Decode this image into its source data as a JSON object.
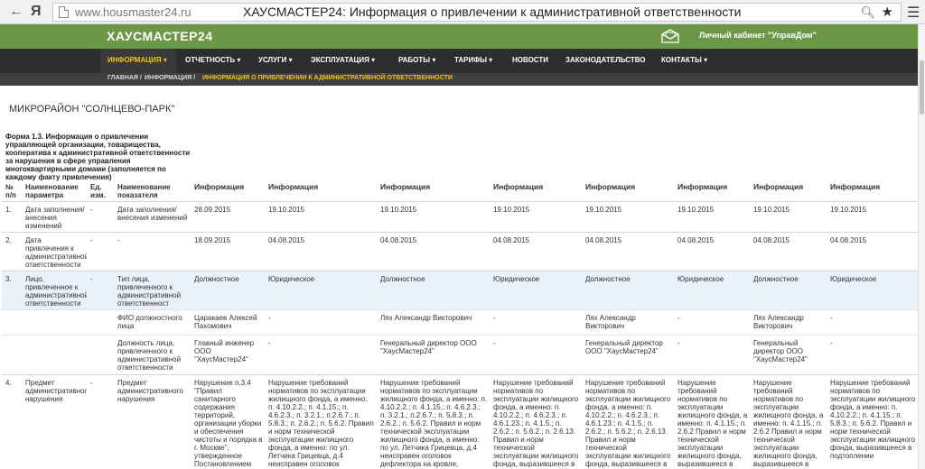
{
  "browser": {
    "back_glyph": "←",
    "brand_glyph": "Я",
    "url": "www.housmaster24.ru",
    "page_title": "ХАУСМАСТЕР24: Информация о привлечении к административной ответственности"
  },
  "header": {
    "logo": "ХАУСМАСТЕР24",
    "cabinet": "Личный кабинет \"УправДом\""
  },
  "nav": {
    "items": [
      {
        "label": "Информация ▾"
      },
      {
        "label": "Отчетность ▾"
      },
      {
        "label": "Услуги ▾"
      },
      {
        "label": "Эксплуатация ▾"
      },
      {
        "label": "Работы ▾"
      },
      {
        "label": "Тарифы ▾"
      },
      {
        "label": "Новости"
      },
      {
        "label": "Законодательство"
      },
      {
        "label": "Контакты ▾"
      }
    ]
  },
  "breadcrumb": {
    "home": "ГЛАВНАЯ /",
    "info": "ИНФОРМАЦИЯ /",
    "current": "ИНФОРМАЦИЯ О ПРИВЛЕЧЕНИИ К АДМИНИСТРАТИВНОЙ ОТВЕТСТВЕННОСТИ"
  },
  "page": {
    "district": "МИКРОРАЙОН \"СОЛНЦЕВО-ПАРК\"",
    "form_title": "Форма 1.3. Информация о привлечении управляющей организации, товарищества, кооператива к административной ответственности за нарушения в сфере управления многоквартирными домами (заполняется по каждому факту привлечения)"
  },
  "table": {
    "headers": {
      "num": "№ п/п",
      "param": "Наименование параметра",
      "unit": "Ед. изм.",
      "indicator": "Наименование показателя",
      "info": "Информация"
    },
    "rows": {
      "r1": {
        "num": "1.",
        "param": "Дата заполнения/ внесения изменений",
        "unit": "-",
        "indicator": "Дата заполнения/ внесения изменений",
        "values": [
          "28.09.2015",
          "19.10.2015",
          "19.10.2015",
          "19.10.2015",
          "19.10.2015",
          "19.10.2015",
          "19.10.2015",
          "19.10.2015"
        ]
      },
      "r2": {
        "num": "2.",
        "param": "Дата привлечения к административной ответственности",
        "unit": "-",
        "indicator": "-",
        "values": [
          "18.09.2015",
          "04.08.2015",
          "04.08.2015",
          "04.08.2015",
          "04.08.2015",
          "04.08.2015",
          "04.08.2015",
          "04.08.2015"
        ]
      },
      "r3a": {
        "num": "3.",
        "param": "Лицо, привлеченное к административной ответственности",
        "unit": "-",
        "indicator": "Тип лица, привлеченного к административной ответственност",
        "values": [
          "Должностное",
          "Юридическое",
          "Должностное",
          "Юридическое",
          "Должностное",
          "Юридическое",
          "Должностное",
          "Юридическое"
        ]
      },
      "r3b": {
        "indicator": "ФИО должностного лица",
        "values": [
          "Царакаев Алексей Пахомович",
          "-",
          "Лях Александр Викторович",
          "-",
          "Лях Александр Викторович",
          "-",
          "Лях Александр Викторович",
          "-"
        ]
      },
      "r3c": {
        "indicator": "Должность лица, привлеченного к административной ответственности",
        "values": [
          "Главный инженер ООО \"ХаусМастер24\"",
          "-",
          "Генеральный директор ООО \"ХаусМастер24\"",
          "-",
          "Генеральный директор ООО \"ХаусМастер24\"",
          "-",
          "Генеральный директор ООО \"ХаусМастер24\"",
          "-"
        ]
      },
      "r4": {
        "num": "4.",
        "param": "Предмет административного нарушения",
        "unit": "-",
        "indicator": "Предмет административного нарушения",
        "values": [
          "Нарушение п.3.4 \"Правил санитарного содержания территорий, организации уборки и обеспечения чистоты и порядка в г. Москве\", утвержденное Постановлением",
          "Нарушение требований нормативов по эксплуатации жилищного фонда, а именно: п. 4.10.2.2.; п. 4.1.15.; п. 4.6.2.3.; п. 3.2.1.; п.2.6.7.; п. 5.8.3.; п. 2.6.2.; п. 5.6.2. Правил и норм технической эксплуатации жилищного фонда, а именно: по ул. Летчика Грицевца, д.4 неисправен оголовок дефлектора на кровле,",
          "Нарушение требований нормативов по эксплуатации жилищного фонда, а именно: п. 4.10.2.2.; п. 4.1.15.; п. 4.6.2.3.; п. 3.2.1.; п.2.6.7.; п. 5.8.3.; п. 2.6.2.; п. 5.6.2. Правил и норм технической эксплуатации жилищного фонда, а именно: по ул. Летчика Грицевца, д.4 неисправен оголовок дефлектора на кровле,",
          "Нарушение требований нормативов по эксплуатации жилищного фонда, а именно: п. 4.10.2.2.; п. 4.6.2.3.; п. 4.6.1.23.; п. 4.1.5.; п. 2.6.2.; п. 5.6.2.; п. 2.6.13. Правил и норм технической эксплуатации жилищного фонда, выразившееся в",
          "Нарушение требований нормативов по эксплуатации жилищного фонда, а именно: п. 4.10.2.2.; п. 4.6.2.3.; п. 4.6.1.23.; п. 4.1.5.; п. 2.6.2.; п. 5.6.2.; п. 2.6.13. Правил и норм технической эксплуатации жилищного фонда, выразившееся в",
          "Нарушение требований нормативов по эксплуатации жилищного фонда, а именно: п. 4.1.15.; п. 2.6.2 Правил и норм технической эксплуатации жилищного фонда, выразившееся в",
          "Нарушение требований нормативов по эксплуатации жилищного фонда, а именно: п. 4.1.15.; п. 2.6.2 Правил и норм технической эксплуатации жилищного фонда, выразившееся в",
          "Нарушение требований нормативов по эксплуатации жилищного фонда, а именно: п. 4.10.2.2.; п. 4.1.15.; п. 5.8.3.; п. 5.6.2. Правил и норм технической эксплуатации жилищного фонда, выразившееся в подтоплении"
        ]
      }
    }
  }
}
